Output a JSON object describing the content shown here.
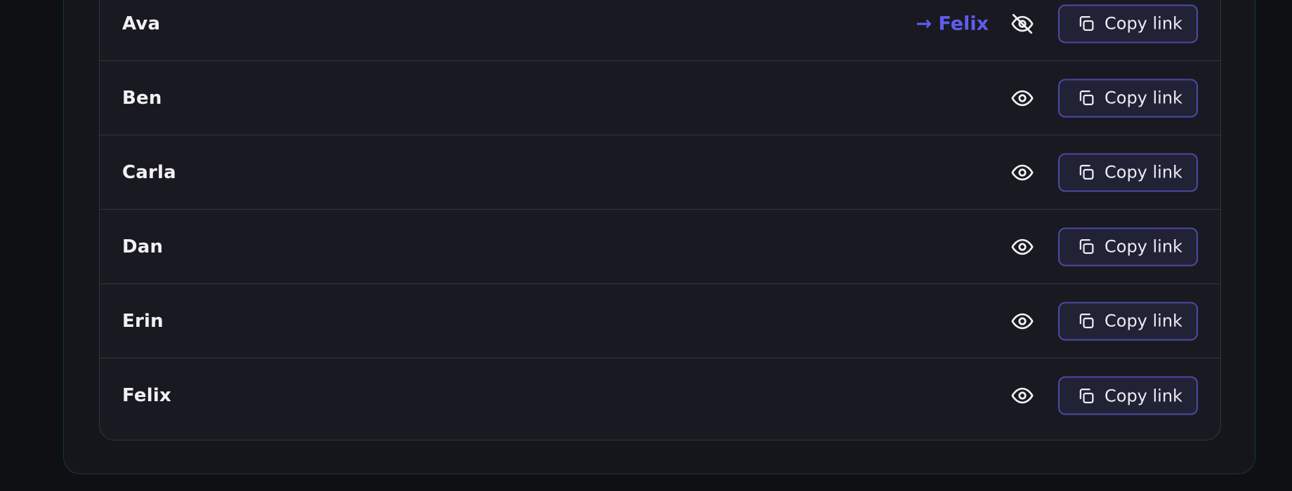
{
  "rows": [
    {
      "name": "Ava",
      "assignment": "→ Felix",
      "visibility": "hidden",
      "copy_label": "Copy link"
    },
    {
      "name": "Ben",
      "assignment": "",
      "visibility": "visible",
      "copy_label": "Copy link"
    },
    {
      "name": "Carla",
      "assignment": "",
      "visibility": "visible",
      "copy_label": "Copy link"
    },
    {
      "name": "Dan",
      "assignment": "",
      "visibility": "visible",
      "copy_label": "Copy link"
    },
    {
      "name": "Erin",
      "assignment": "",
      "visibility": "visible",
      "copy_label": "Copy link"
    },
    {
      "name": "Felix",
      "assignment": "",
      "visibility": "visible",
      "copy_label": "Copy link"
    }
  ],
  "icons": {
    "visible": "eye-icon",
    "hidden": "eye-off-icon",
    "copy": "copy-icon"
  },
  "colors": {
    "accent": "#5f5cf0",
    "button_border": "#4a4aa6",
    "button_bg": "#212236",
    "panel_bg": "#191a21",
    "page_bg": "#0f1014",
    "outer_border": "#123b30"
  }
}
